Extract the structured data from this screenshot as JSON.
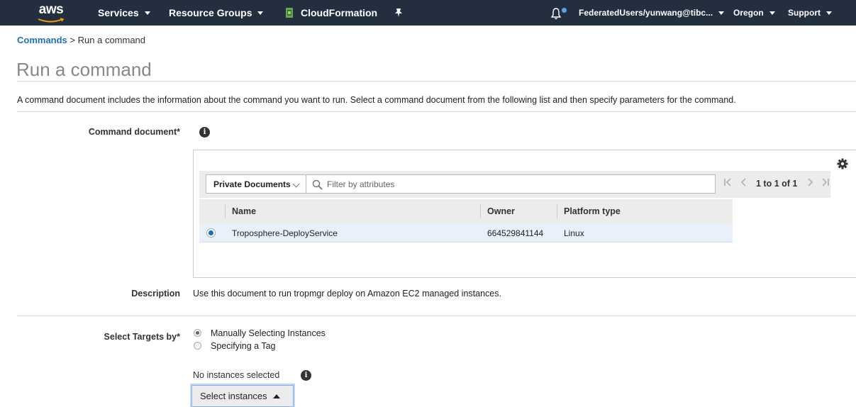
{
  "nav": {
    "logo": "aws",
    "services": "Services",
    "resource_groups": "Resource Groups",
    "cloudformation": "CloudFormation",
    "user": "FederatedUsers/yunwang@tibc...",
    "region": "Oregon",
    "support": "Support",
    "accent_color": "#232f3e",
    "notification_dot_color": "#5aa4ef"
  },
  "breadcrumb": {
    "parent": "Commands",
    "separator": ">",
    "current": "Run a command"
  },
  "page_title": "Run a command",
  "intro": "A command document includes the information about the command you want to run. Select a command document from the following list and then specify parameters for the command.",
  "command_document": {
    "label": "Command document*",
    "filter_select": "Private Documents",
    "filter_placeholder": "Filter by attributes",
    "pager_text": "1 to 1 of 1",
    "columns": [
      "Name",
      "Owner",
      "Platform type"
    ],
    "rows": [
      {
        "selected": true,
        "name": "Troposphere-DeployService",
        "owner": "664529841144",
        "platform": "Linux"
      }
    ]
  },
  "description": {
    "label": "Description",
    "text": "Use this document to run tropmgr deploy on Amazon EC2 managed instances."
  },
  "targets": {
    "label": "Select Targets by*",
    "options": [
      {
        "label": "Manually Selecting Instances",
        "selected": true
      },
      {
        "label": "Specifying a Tag",
        "selected": false
      }
    ],
    "status": "No instances selected",
    "button": "Select instances"
  }
}
